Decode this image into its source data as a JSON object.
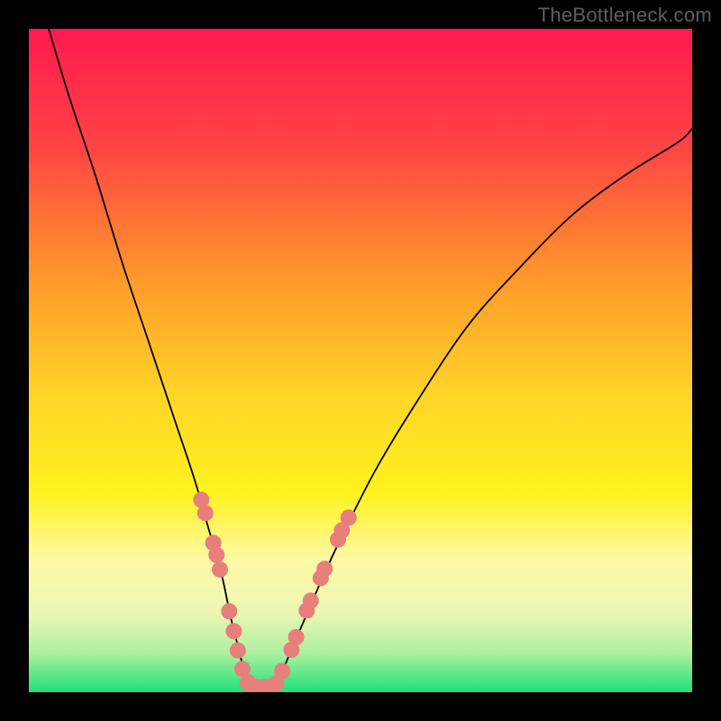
{
  "watermark": "TheBottleneck.com",
  "chart_data": {
    "type": "line",
    "title": "",
    "xlabel": "",
    "ylabel": "",
    "xlim": [
      0,
      100
    ],
    "ylim": [
      0,
      100
    ],
    "background": {
      "gradient_stops": [
        {
          "offset": 0,
          "color": "#ff1a4f"
        },
        {
          "offset": 18,
          "color": "#ff4444"
        },
        {
          "offset": 38,
          "color": "#ff9a2a"
        },
        {
          "offset": 55,
          "color": "#ffd428"
        },
        {
          "offset": 70,
          "color": "#fff21f"
        },
        {
          "offset": 80,
          "color": "#fff9a6"
        },
        {
          "offset": 88,
          "color": "#ecf7b4"
        },
        {
          "offset": 94,
          "color": "#aef0a0"
        },
        {
          "offset": 100,
          "color": "#1fe07a"
        }
      ]
    },
    "series": [
      {
        "name": "left-branch",
        "x": [
          3,
          6,
          10,
          14,
          18,
          22,
          25,
          27,
          29,
          30.5,
          32,
          33
        ],
        "y": [
          100,
          90,
          78,
          65,
          53,
          41,
          32,
          25,
          18,
          11,
          5,
          0
        ]
      },
      {
        "name": "right-branch",
        "x": [
          37,
          39,
          42,
          46,
          52,
          58,
          66,
          74,
          82,
          90,
          98,
          100
        ],
        "y": [
          0,
          5,
          12,
          21,
          33,
          43,
          55,
          64,
          72,
          78,
          83,
          85
        ]
      },
      {
        "name": "valley-floor",
        "x": [
          33,
          34,
          35,
          36,
          37
        ],
        "y": [
          0,
          0,
          0,
          0,
          0
        ]
      }
    ],
    "markers": [
      {
        "x": 26.0,
        "y": 29.0
      },
      {
        "x": 26.6,
        "y": 27.0
      },
      {
        "x": 27.8,
        "y": 22.5
      },
      {
        "x": 28.3,
        "y": 20.7
      },
      {
        "x": 28.8,
        "y": 18.5
      },
      {
        "x": 30.2,
        "y": 12.2
      },
      {
        "x": 30.9,
        "y": 9.2
      },
      {
        "x": 31.5,
        "y": 6.3
      },
      {
        "x": 32.2,
        "y": 3.5
      },
      {
        "x": 33.0,
        "y": 1.5
      },
      {
        "x": 34.2,
        "y": 0.8
      },
      {
        "x": 35.3,
        "y": 0.8
      },
      {
        "x": 36.4,
        "y": 0.8
      },
      {
        "x": 37.3,
        "y": 1.3
      },
      {
        "x": 38.2,
        "y": 3.2
      },
      {
        "x": 39.6,
        "y": 6.4
      },
      {
        "x": 40.3,
        "y": 8.3
      },
      {
        "x": 41.9,
        "y": 12.3
      },
      {
        "x": 42.5,
        "y": 13.8
      },
      {
        "x": 44.0,
        "y": 17.2
      },
      {
        "x": 44.6,
        "y": 18.6
      },
      {
        "x": 46.6,
        "y": 23.0
      },
      {
        "x": 47.2,
        "y": 24.4
      },
      {
        "x": 48.2,
        "y": 26.3
      }
    ],
    "marker_style": {
      "color": "#e77f7a",
      "radius_px": 9
    }
  }
}
